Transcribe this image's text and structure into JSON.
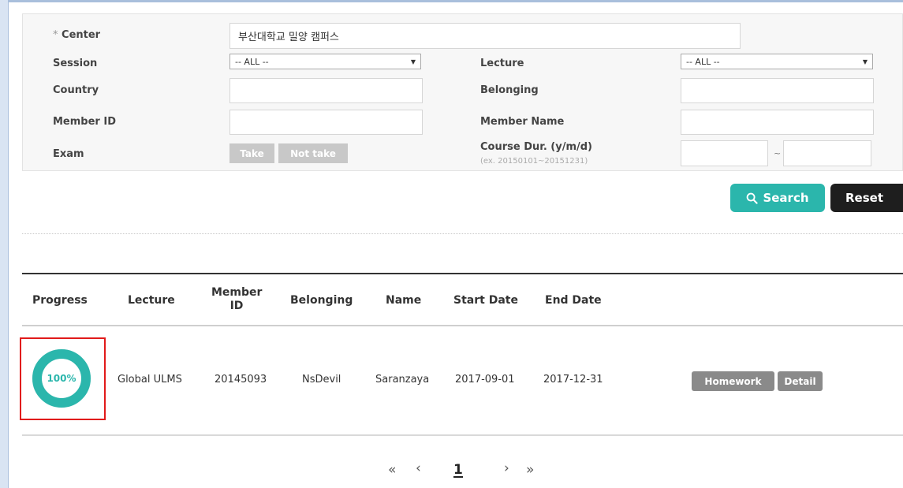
{
  "search_form": {
    "center": {
      "label": "Center",
      "required_mark": "*",
      "value": "부산대학교 밀양 캠퍼스"
    },
    "session": {
      "label": "Session",
      "selected": "-- ALL --"
    },
    "lecture": {
      "label": "Lecture",
      "selected": "-- ALL --"
    },
    "country": {
      "label": "Country",
      "value": ""
    },
    "belonging": {
      "label": "Belonging",
      "value": ""
    },
    "member_id": {
      "label": "Member ID",
      "value": ""
    },
    "member_name": {
      "label": "Member Name",
      "value": ""
    },
    "exam": {
      "label": "Exam",
      "take_label": "Take",
      "not_take_label": "Not take"
    },
    "course_duration": {
      "label": "Course Dur. (y/m/d)",
      "hint": "(ex. 20150101~20151231)",
      "separator": "~",
      "from": "",
      "to": ""
    }
  },
  "actions": {
    "search_label": "Search",
    "reset_label": "Reset"
  },
  "table": {
    "headers": {
      "progress": "Progress",
      "lecture": "Lecture",
      "member_id_line1": "Member",
      "member_id_line2": "ID",
      "belonging": "Belonging",
      "name": "Name",
      "start_date": "Start Date",
      "end_date": "End Date"
    },
    "rows": [
      {
        "progress": "100%",
        "progress_fraction": 1.0,
        "lecture": "Global ULMS",
        "member_id": "20145093",
        "belonging": "NsDevil",
        "name": "Saranzaya",
        "start_date": "2017-09-01",
        "end_date": "2017-12-31",
        "homework_label": "Homework",
        "detail_label": "Detail"
      }
    ]
  },
  "pagination": {
    "first": "«",
    "prev": "‹",
    "current": "1",
    "next": "›",
    "last": "»"
  },
  "colors": {
    "accent": "#2bb6ac",
    "dark_button": "#1e1e1e",
    "highlight": "#e11a1a",
    "gray_button": "#8a8a8a"
  }
}
